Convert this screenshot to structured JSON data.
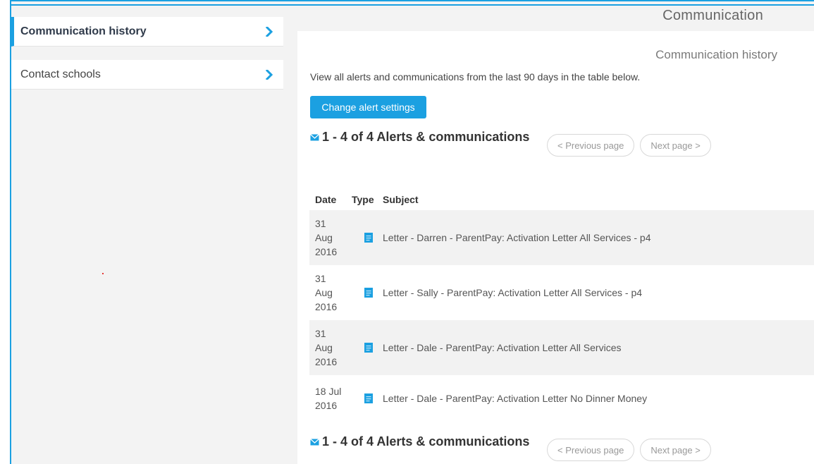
{
  "page": {
    "title": "Communication"
  },
  "sidebar": {
    "items": [
      {
        "label": "Communication history",
        "active": true
      },
      {
        "label": "Contact schools",
        "active": false
      }
    ]
  },
  "main": {
    "section_title": "Communication history",
    "intro": "View all alerts and communications from the last 90 days in the table below.",
    "change_alert_button": "Change alert settings",
    "count_label": "1 - 4 of 4 Alerts & communications",
    "pager": {
      "previous": "< Previous page",
      "next": "Next page >"
    },
    "table": {
      "headers": {
        "date": "Date",
        "type": "Type",
        "subject": "Subject"
      },
      "rows": [
        {
          "date_day": "31",
          "date_month": "Aug",
          "date_year": "2016",
          "type_icon": "letter-icon",
          "subject": "Letter - Darren - ParentPay: Activation Letter All Services - p4"
        },
        {
          "date_day": "31",
          "date_month": "Aug",
          "date_year": "2016",
          "type_icon": "letter-icon",
          "subject": "Letter - Sally - ParentPay: Activation Letter All Services - p4"
        },
        {
          "date_day": "31",
          "date_month": "Aug",
          "date_year": "2016",
          "type_icon": "letter-icon",
          "subject": "Letter - Dale - ParentPay: Activation Letter All Services"
        },
        {
          "date_day": "18 Jul",
          "date_month": "2016",
          "date_year": "",
          "type_icon": "letter-icon",
          "subject": "Letter - Dale - ParentPay: Activation Letter No Dinner Money"
        }
      ]
    }
  },
  "colors": {
    "accent": "#1ba0e1",
    "sidebar_bg": "#f3f3f3",
    "row_alt": "#f2f2f2"
  }
}
